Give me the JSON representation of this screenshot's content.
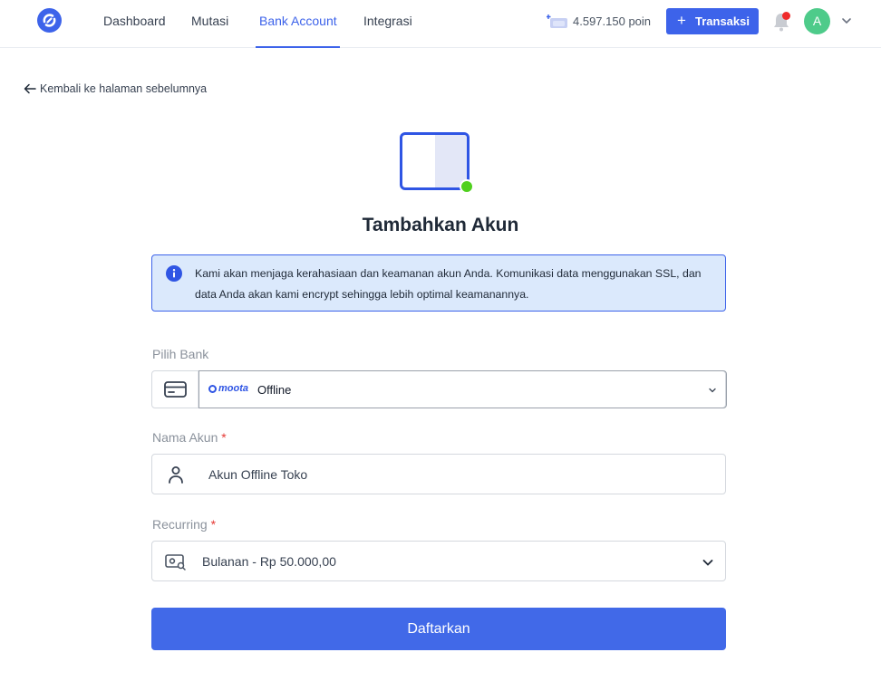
{
  "nav": {
    "logo": "app-logo",
    "links": [
      {
        "label": "Dashboard",
        "active": false
      },
      {
        "label": "Mutasi",
        "active": false
      },
      {
        "label": "Bank Account",
        "active": true
      },
      {
        "label": "Integrasi",
        "active": false
      }
    ],
    "points_label": "4.597.150 poin",
    "transaksi_label": "Transaksi",
    "avatar_initial": "A",
    "accent_color": "#3d63ea",
    "notification_dot_color": "#ef2b2b"
  },
  "back": {
    "label": "Kembali ke halaman sebelumnya"
  },
  "page": {
    "title": "Tambahkan Akun",
    "status_dot_color": "#4fd01e"
  },
  "alert": {
    "icon": "info-icon",
    "message": "Kami akan menjaga kerahasiaan dan keamanan akun Anda. Komunikasi data menggunakan SSL, dan data Anda akan kami encrypt sehingga lebih optimal keamanannya."
  },
  "form": {
    "bank": {
      "label": "Pilih Bank",
      "brand": "moota",
      "value": "Offline",
      "icon": "credit-card-icon"
    },
    "nama": {
      "label": "Nama Akun",
      "required_mark": "*",
      "value": "Akun Offline Toko",
      "icon": "user-icon"
    },
    "recurring": {
      "label": "Recurring",
      "required_mark": "*",
      "value": "Bulanan - Rp 50.000,00",
      "icon": "cash-icon"
    },
    "submit_label": "Daftarkan"
  }
}
